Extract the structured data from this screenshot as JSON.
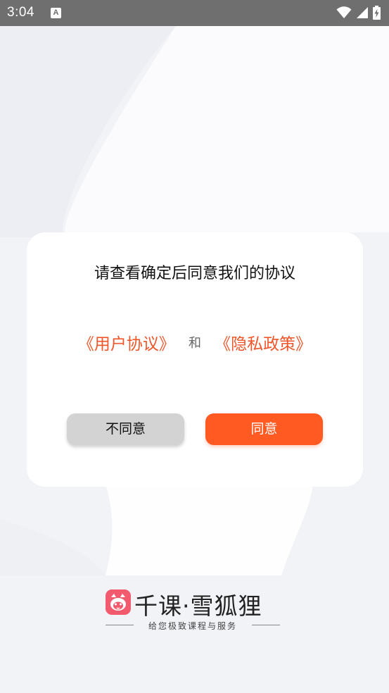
{
  "status_bar": {
    "time": "3:04",
    "notification_icon": "text-a-icon",
    "notification_glyph": "A",
    "icons": [
      "wifi-icon",
      "signal-icon",
      "battery-charging-icon"
    ]
  },
  "dialog": {
    "title": "请查看确定后同意我们的协议",
    "user_agreement_link": "《用户协议》",
    "and_text": "和",
    "privacy_policy_link": "《隐私政策》",
    "disagree_label": "不同意",
    "agree_label": "同意"
  },
  "brand": {
    "logo_icon": "fox-logo-icon",
    "name": "千课·雪狐狸",
    "slogan": "给您极致课程与服务"
  },
  "colors": {
    "accent": "#ff5a22",
    "link": "#f0562a",
    "status_bar": "#6f6f6f",
    "disagree_button": "#d3d3d3",
    "logo": "#f25a6e"
  }
}
